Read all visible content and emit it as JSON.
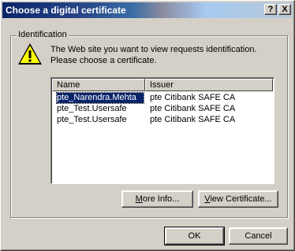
{
  "window": {
    "title": "Choose a digital certificate",
    "help_button": "?",
    "close_button": "X"
  },
  "group": {
    "label": "Identification"
  },
  "message": "The Web site you want to view requests identification. Please choose a certificate.",
  "list": {
    "columns": [
      "Name",
      "Issuer"
    ],
    "rows": [
      {
        "name": "pte_Narendra.Mehta",
        "issuer": "pte Citibank SAFE CA",
        "selected": true
      },
      {
        "name": "pte_Test.Usersafe",
        "issuer": "pte Citibank SAFE CA",
        "selected": false
      },
      {
        "name": "pte_Test.Usersafe",
        "issuer": "pte Citibank SAFE CA",
        "selected": false
      }
    ]
  },
  "buttons": {
    "more_info": {
      "accel": "M",
      "rest": "ore Info..."
    },
    "view_certificate": {
      "accel": "V",
      "rest": "iew Certificate..."
    },
    "ok": "OK",
    "cancel": "Cancel"
  },
  "colors": {
    "face": "#d4d0c8",
    "selection": "#0a246a",
    "title_start": "#0a246a",
    "title_end": "#a6caf0"
  },
  "icons": {
    "warning": "warning-icon"
  }
}
